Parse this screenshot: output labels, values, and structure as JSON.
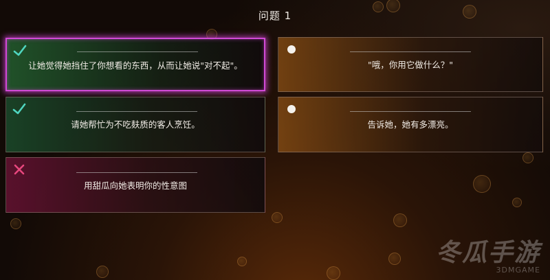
{
  "question_title": "问题 1",
  "answers": [
    {
      "text": "让她觉得她挡住了你想看的东西，从而让她说\"对不起\"。",
      "marker": "check-icon"
    },
    {
      "text": "\"哦，你用它做什么？\"",
      "marker": "dot-icon"
    },
    {
      "text": "请她帮忙为不吃麸质的客人烹饪。",
      "marker": "check-icon"
    },
    {
      "text": "告诉她，她有多漂亮。",
      "marker": "dot-icon"
    },
    {
      "text": "用甜瓜向她表明你的性意图",
      "marker": "cross-icon"
    }
  ],
  "colors": {
    "check": "#4fd6c0",
    "cross": "#e8477e",
    "selected_border": "#d14ad6"
  },
  "watermark": {
    "main": "冬瓜手游",
    "sub": "3DMGAME"
  }
}
